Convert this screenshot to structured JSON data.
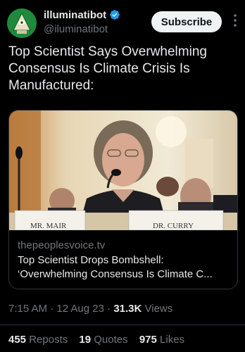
{
  "author": {
    "display_name": "illuminatibot",
    "handle": "@iluminatibot",
    "verified": true,
    "avatar": "eye-pyramid-avatar"
  },
  "subscribe_label": "Subscribe",
  "tweet_text": "Top Scientist Says Overwhelming Consensus Is Climate Crisis Is Manufactured:",
  "card": {
    "domain": "thepeoplesvoice.tv",
    "title_line1": "Top Scientist Drops Bombshell:",
    "title_line2": "‘Overwhelming Consensus Is Climate C...",
    "image": {
      "description_icon": "hearing-photo",
      "nameplate_left": "MR. MAIR",
      "nameplate_right": "DR. CURRY"
    }
  },
  "meta": {
    "time": "7:15 AM",
    "date": "12 Aug 23",
    "views_count": "31.3K",
    "views_label": "Views"
  },
  "stats": {
    "reposts_count": "455",
    "reposts_label": "Reposts",
    "quotes_count": "19",
    "quotes_label": "Quotes",
    "likes_count": "975",
    "likes_label": "Likes"
  },
  "colors": {
    "background": "#000000",
    "text": "#e7e9ea",
    "secondary_text": "#71767b",
    "verified_blue": "#1d9bf0",
    "avatar_green": "#1f8a3b"
  }
}
